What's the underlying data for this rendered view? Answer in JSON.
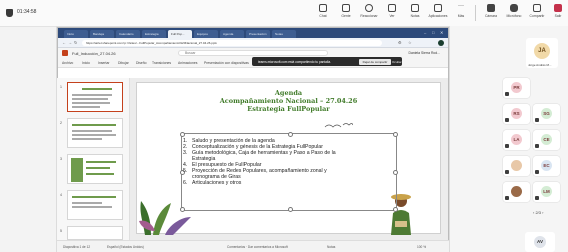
{
  "meeting": {
    "timer": "01:34:58",
    "toolbar": [
      {
        "label": "Chat",
        "icon": "chat-icon"
      },
      {
        "label": "Gente",
        "icon": "people-icon"
      },
      {
        "label": "Reaccionar",
        "icon": "reaction-icon"
      },
      {
        "label": "Ver",
        "icon": "view-icon"
      },
      {
        "label": "Notas",
        "icon": "notes-icon"
      },
      {
        "label": "Aplicaciones",
        "icon": "apps-icon"
      },
      {
        "label": "Más",
        "icon": "more-icon"
      },
      {
        "label": "Cámara",
        "icon": "camera-icon"
      },
      {
        "label": "Micrófono",
        "icon": "microphone-icon"
      },
      {
        "label": "Compartir",
        "icon": "share-icon"
      },
      {
        "label": "Salir",
        "icon": "leave-icon"
      }
    ]
  },
  "browser": {
    "url": "https://airtel.sharepoint.com/:p:/r/sites/...FullPopular_Acompañamiento%20Nacional_27.04.26.pptx",
    "tabs": [
      "Inicio",
      "Bandeja",
      "Calendario",
      "Estrategia",
      "Full Pop...",
      "Equipos",
      "Agenda",
      "Presentación",
      "Notas"
    ]
  },
  "powerpoint": {
    "filename": "Full_Inducción_27.04.26",
    "search_placeholder": "Buscar",
    "user": "Daniela Sierra Rod...",
    "menu": [
      "Archivo",
      "Inicio",
      "Insertar",
      "Dibujar",
      "Diseño",
      "Transiciones",
      "Animaciones",
      "Presentación con diapositivas",
      "Revisar",
      "Vista",
      "Ayuda"
    ],
    "notification": {
      "text": "teams.microsoft.com está compartiendo tu pantalla.",
      "stop": "Dejar de compartir",
      "hide": "Ocultar"
    },
    "status": {
      "left": "Diapositiva 1 de 12",
      "lang": "Español (Estados Unidos)",
      "center": "Comentarios · Dar comentarios a Microsoft",
      "notes": "Notas",
      "zoom": "100 %"
    }
  },
  "slide": {
    "title1": "Agenda",
    "title2": "Acompañamiento Nacional – 27.04.26",
    "title3": "Estrategia FullPopular",
    "items": [
      {
        "num": "1.",
        "text": "Saludo y presentación de la agenda"
      },
      {
        "num": "2.",
        "text": "Conceptualización y génesis de la Estrategia FullPopular"
      },
      {
        "num": "3.",
        "text": "Guía metodológica, Caja de herramientas y Paso a Paso de la"
      },
      {
        "num": "",
        "text": "Estrategia"
      },
      {
        "num": "4.",
        "text": "El presupuesto de FullPopular"
      },
      {
        "num": "5.",
        "text": "Proyección de Redes Populares, acompañamiento zonal y"
      },
      {
        "num": "",
        "text": "cronograma de Giras"
      },
      {
        "num": "6.",
        "text": "Articulaciones y otros"
      }
    ]
  },
  "participants": {
    "featured": {
      "initials": "JA",
      "name": "Jorge Andrés M..."
    },
    "tiles": [
      {
        "initials": "PR",
        "color": "#f2c9cf"
      },
      {
        "initials": "RS",
        "color": "#f2c9cf"
      },
      {
        "initials": "SG",
        "color": "#d4ecd4"
      },
      {
        "initials": "LA",
        "color": "#f2c9cf"
      },
      {
        "initials": "CE",
        "color": "#d4ecd4"
      },
      {
        "initials": "",
        "color": "#e8c8a8"
      },
      {
        "initials": "EC",
        "color": "#d9e5f2"
      },
      {
        "initials": "",
        "color": "#9a6a48"
      },
      {
        "initials": "LM",
        "color": "#d4ecd4"
      }
    ],
    "pager": "‹  2/3  ›",
    "self_initials": "AV"
  }
}
